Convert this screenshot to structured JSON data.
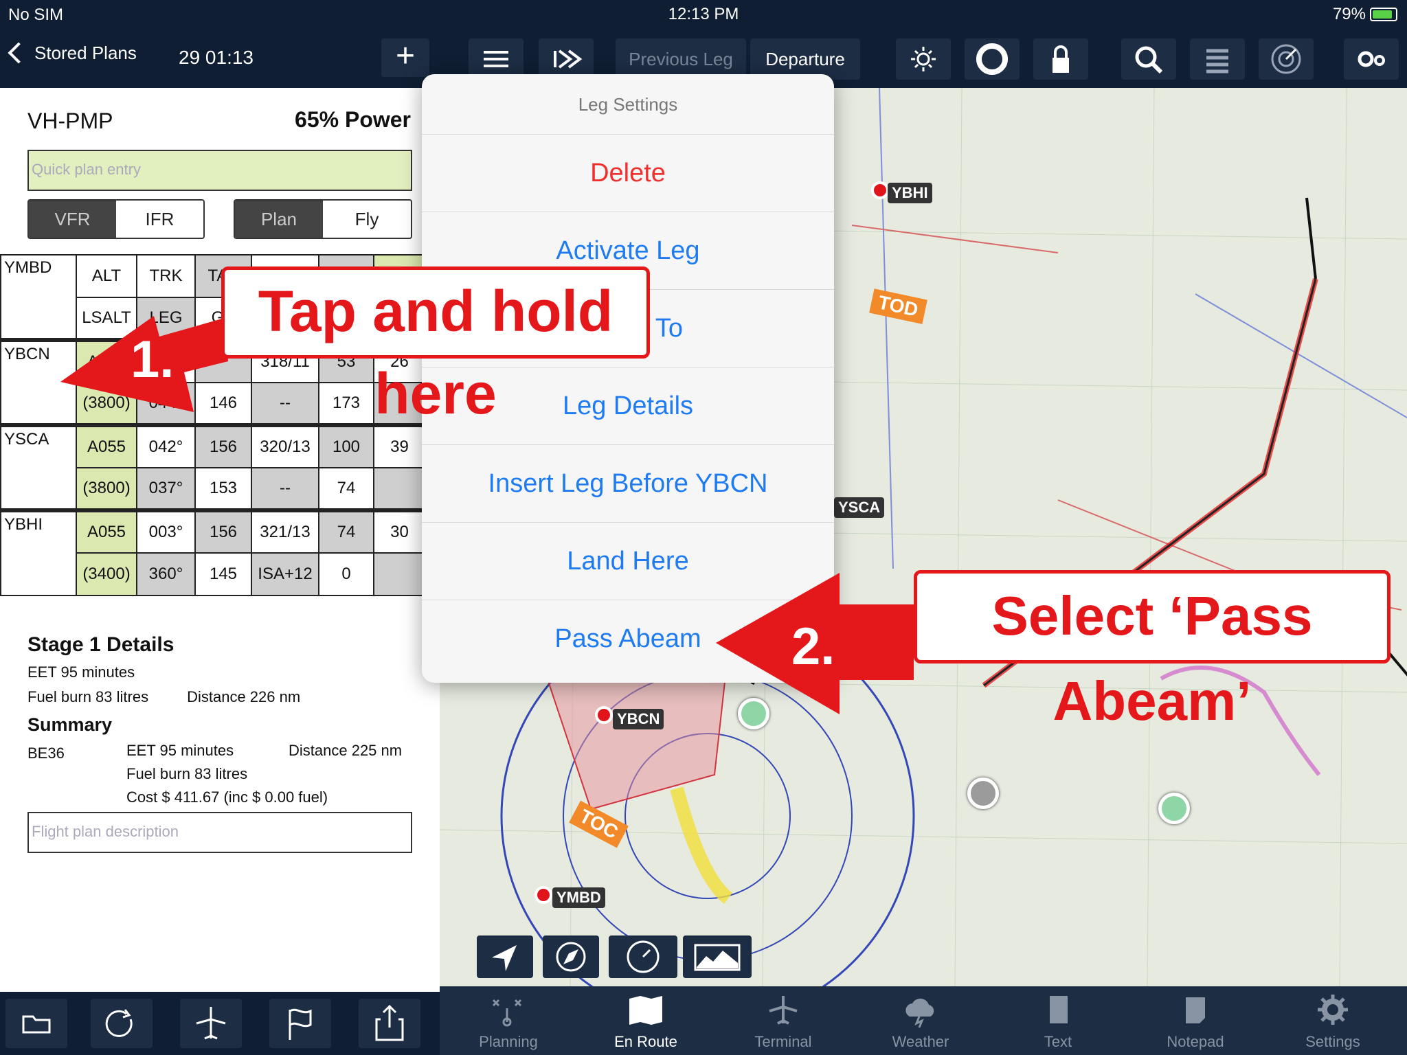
{
  "status": {
    "carrier": "No SIM",
    "time": "12:13 PM",
    "battery": "79%"
  },
  "left": {
    "back_label": "Stored Plans",
    "plan_time": "29 01:13",
    "aircraft": "VH-PMP",
    "power": "65% Power",
    "quick_placeholder": "Quick plan entry",
    "vfr": "VFR",
    "ifr": "IFR",
    "plan": "Plan",
    "fly": "Fly",
    "header": {
      "wp": "YMBD",
      "alt": "ALT",
      "lsalt": "LSALT",
      "trk": "TRK",
      "trk2": "LEG",
      "c3": "TAS",
      "c3b": "GS"
    },
    "rows": [
      {
        "wp": "YBCN",
        "alt": "A055",
        "lsalt": "(3800)",
        "trk": "",
        "trk2": "044°",
        "c3": "",
        "c3b": "146",
        "c4": "318/11",
        "c4b": "--",
        "c5": "53",
        "c5b": "173",
        "c6": "26",
        "c6b": ""
      },
      {
        "wp": "YSCA",
        "alt": "A055",
        "lsalt": "(3800)",
        "trk": "042°",
        "trk2": "037°",
        "c3": "156",
        "c3b": "153",
        "c4": "320/13",
        "c4b": "--",
        "c5": "100",
        "c5b": "74",
        "c6": "39",
        "c6b": ""
      },
      {
        "wp": "YBHI",
        "alt": "A055",
        "lsalt": "(3400)",
        "trk": "003°",
        "trk2": "360°",
        "c3": "156",
        "c3b": "145",
        "c4": "321/13",
        "c4b": "ISA+12",
        "c5": "74",
        "c5b": "0",
        "c6": "30",
        "c6b": ""
      }
    ],
    "stage_title": "Stage 1 Details",
    "stage_eet": "EET 95 minutes",
    "stage_fuel": "Fuel burn 83 litres",
    "stage_dist": "Distance 226 nm",
    "summary_title": "Summary",
    "summary_ac": "BE36",
    "summary_eet": "EET 95 minutes",
    "summary_dist": "Distance 225 nm",
    "summary_fuel": "Fuel burn 83 litres",
    "summary_cost": "Cost $ 411.67 (inc $ 0.00 fuel)",
    "desc_placeholder": "Flight plan description"
  },
  "toolbar": {
    "prev": "Previous Leg",
    "next": "Departure"
  },
  "popover": {
    "title": "Leg Settings",
    "items": [
      "Delete",
      "Activate Leg",
      "To",
      "Leg Details",
      "Insert Leg Before YBCN",
      "Land Here",
      "Pass Abeam"
    ]
  },
  "callouts": {
    "c1": "Tap and hold here",
    "n1": "1.",
    "c2": "Select ‘Pass Abeam’",
    "n2": "2."
  },
  "map": {
    "ybhi": "YBHI",
    "ysca": "YSCA",
    "ybcn": "YBCN",
    "ymbd": "YMBD",
    "tod": "TOD",
    "toc": "TOC"
  },
  "tabs": [
    "Planning",
    "En Route",
    "Terminal",
    "Weather",
    "Text",
    "Notepad",
    "Settings"
  ]
}
